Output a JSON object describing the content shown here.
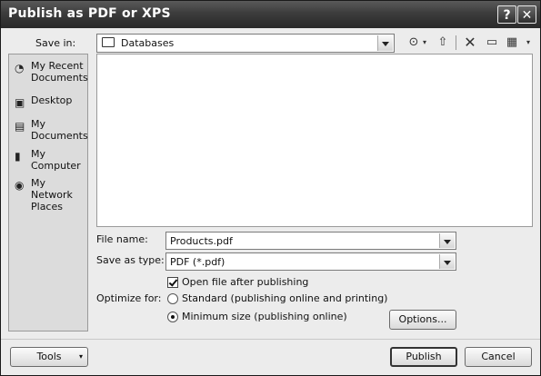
{
  "window": {
    "title": "Publish as PDF or XPS"
  },
  "title_buttons": {
    "help": "?",
    "close": "✕"
  },
  "save_in": {
    "label": "Save in:",
    "value": "Databases"
  },
  "toolbar": {
    "icons": [
      "back-icon",
      "up-folder-icon",
      "delete-icon",
      "new-folder-icon",
      "views-icon"
    ]
  },
  "places": [
    {
      "label": "My Recent Documents",
      "icon": "recent-documents-icon"
    },
    {
      "label": "Desktop",
      "icon": "desktop-icon"
    },
    {
      "label": "My Documents",
      "icon": "my-documents-icon"
    },
    {
      "label": "My Computer",
      "icon": "my-computer-icon"
    },
    {
      "label": "My Network Places",
      "icon": "network-places-icon"
    }
  ],
  "file_name": {
    "label": "File name:",
    "value": "Products.pdf"
  },
  "save_as_type": {
    "label": "Save as type:",
    "value": "PDF (*.pdf)"
  },
  "open_after": {
    "label": "Open file after publishing",
    "checked": true
  },
  "optimize": {
    "label": "Optimize for:",
    "options": [
      {
        "label": "Standard (publishing online and printing)",
        "selected": false
      },
      {
        "label": "Minimum size (publishing online)",
        "selected": true
      }
    ]
  },
  "buttons": {
    "options": "Options...",
    "tools": "Tools",
    "publish": "Publish",
    "cancel": "Cancel"
  }
}
